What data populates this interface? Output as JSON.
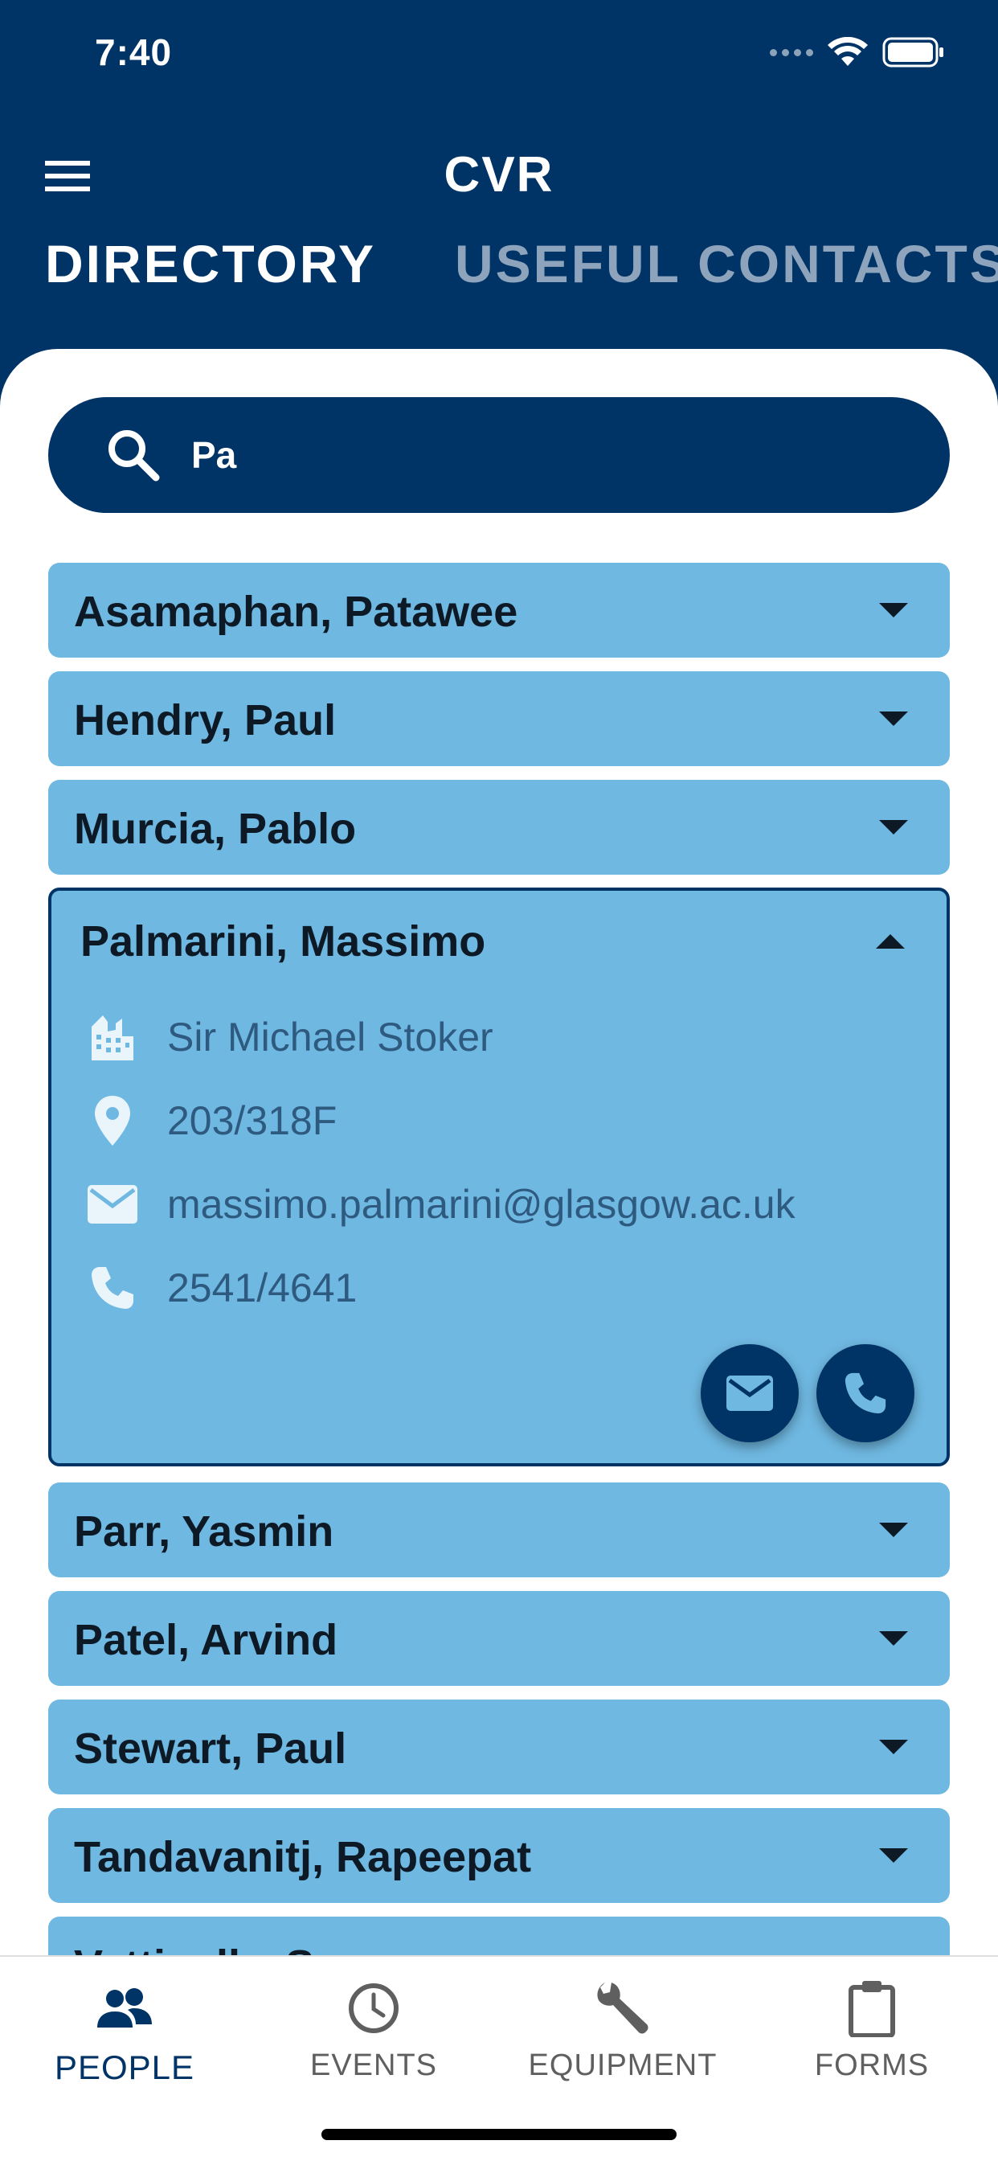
{
  "status_bar": {
    "time": "7:40"
  },
  "header": {
    "title": "CVR",
    "tabs": [
      {
        "label": "DIRECTORY",
        "active": true
      },
      {
        "label": "USEFUL CONTACTS",
        "active": false
      }
    ]
  },
  "search": {
    "value": "Pa",
    "placeholder": ""
  },
  "people": [
    {
      "name": "Asamaphan, Patawee"
    },
    {
      "name": "Hendry, Paul"
    },
    {
      "name": "Murcia, Pablo"
    },
    {
      "name": "Palmarini, Massimo",
      "expanded": true,
      "building": "Sir Michael Stoker",
      "room": "203/318F",
      "email": "massimo.palmarini@glasgow.ac.uk",
      "phone": "2541/4641"
    },
    {
      "name": "Parr, Yasmin"
    },
    {
      "name": "Patel, Arvind"
    },
    {
      "name": "Stewart, Paul"
    },
    {
      "name": "Tandavanitj, Rapeepat"
    },
    {
      "name": "Vattipally, Sreenu"
    }
  ],
  "bottom_nav": [
    {
      "label": "PEOPLE",
      "icon": "people-icon",
      "active": true
    },
    {
      "label": "EVENTS",
      "icon": "clock-icon",
      "active": false
    },
    {
      "label": "EQUIPMENT",
      "icon": "wrench-icon",
      "active": false
    },
    {
      "label": "FORMS",
      "icon": "clipboard-icon",
      "active": false
    }
  ],
  "colors": {
    "primary": "#003366",
    "card": "#6fb8e1",
    "detail_text": "#2f5a80",
    "inactive_tab": "#8ea4bd"
  }
}
